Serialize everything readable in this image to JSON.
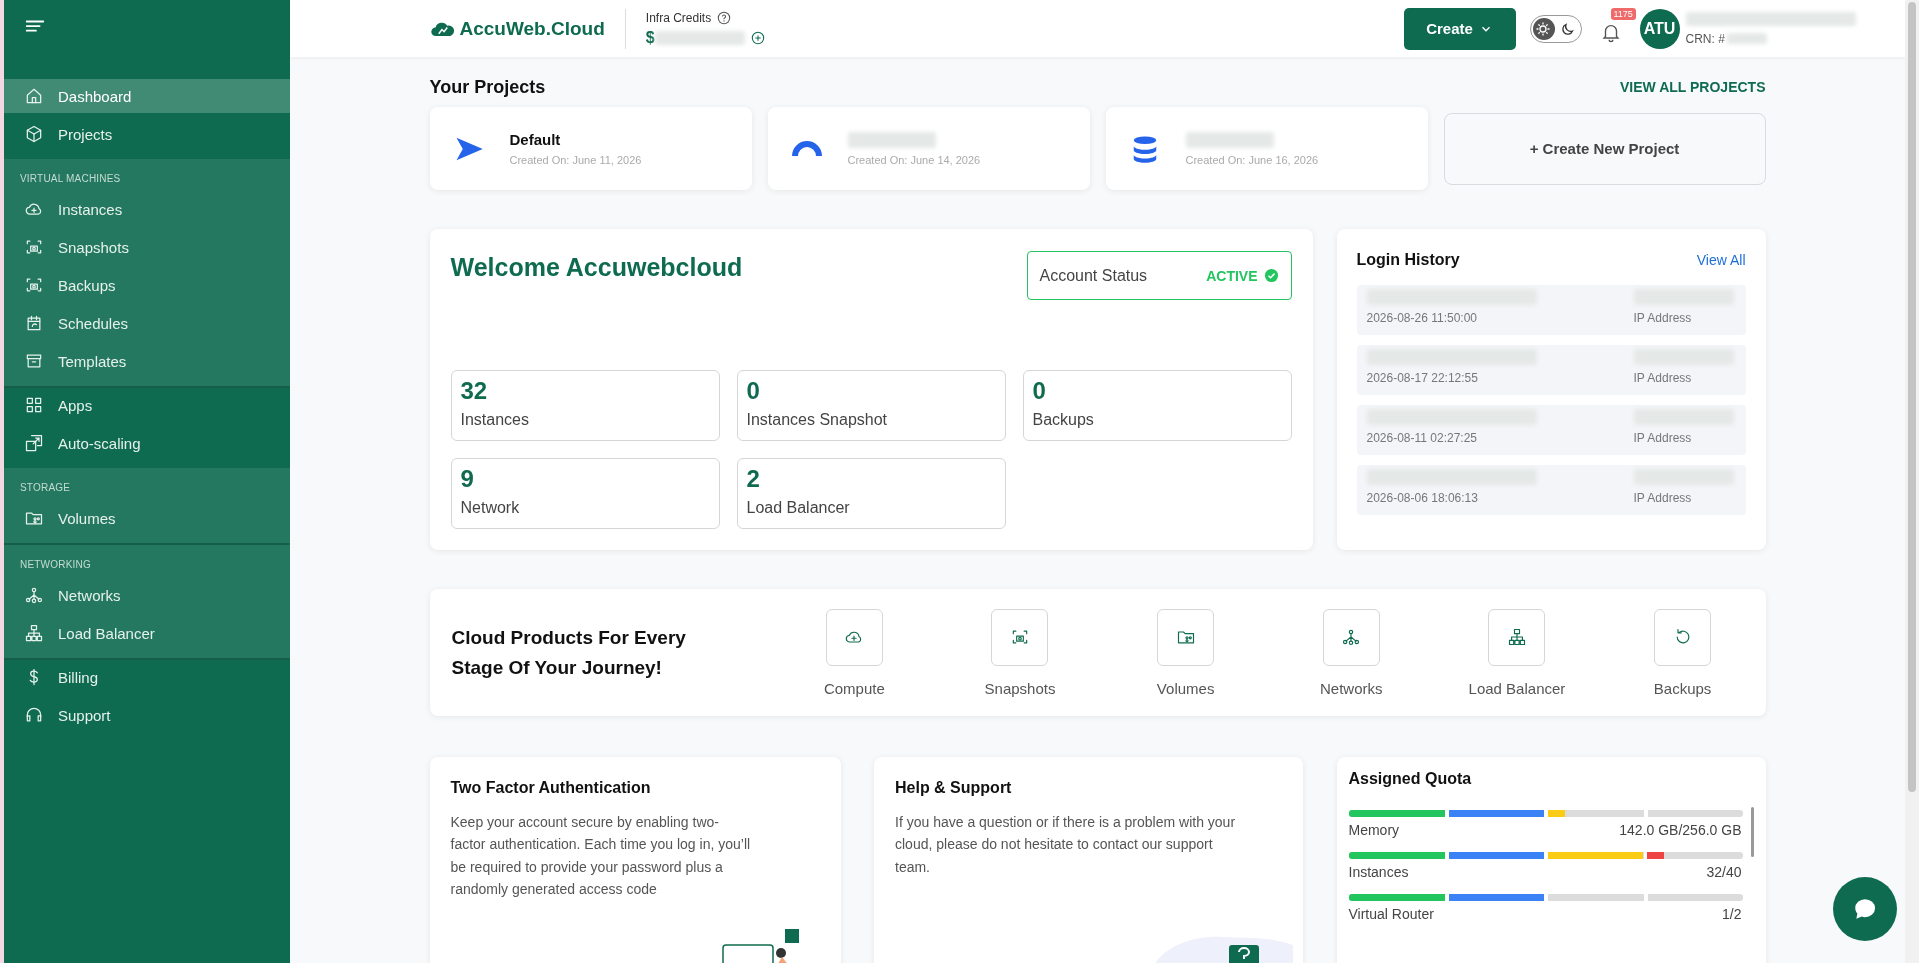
{
  "sidebar": {
    "sections": [
      {
        "kind": "main",
        "items": [
          {
            "label": "Dashboard",
            "selected": true
          },
          {
            "label": "Projects",
            "selected": false
          }
        ]
      },
      {
        "kind": "group",
        "heading": "VIRTUAL MACHINES",
        "items": [
          {
            "label": "Instances",
            "selected": false
          },
          {
            "label": "Snapshots",
            "selected": false
          },
          {
            "label": "Backups",
            "selected": false
          },
          {
            "label": "Schedules",
            "selected": false
          },
          {
            "label": "Templates",
            "selected": false
          }
        ]
      },
      {
        "kind": "main",
        "items": [
          {
            "label": "Apps",
            "selected": false
          },
          {
            "label": "Auto-scaling",
            "selected": false
          }
        ]
      },
      {
        "kind": "group",
        "heading": "STORAGE",
        "items": [
          {
            "label": "Volumes",
            "selected": false
          }
        ]
      },
      {
        "kind": "group",
        "heading": "NETWORKING",
        "items": [
          {
            "label": "Networks",
            "selected": false
          },
          {
            "label": "Load Balancer",
            "selected": false
          }
        ]
      },
      {
        "kind": "main",
        "items": [
          {
            "label": "Billing",
            "selected": false
          },
          {
            "label": "Support",
            "selected": false
          }
        ]
      }
    ]
  },
  "header": {
    "logo": "AccuWeb.Cloud",
    "credits_label": "Infra Credits",
    "credits_value": "$",
    "create_button": "Create",
    "dark_mode": false,
    "notifications": "1175",
    "avatar": "ATU",
    "crn": "CRN: #"
  },
  "projects": {
    "title": "Your Projects",
    "view_all": "VIEW ALL PROJECTS",
    "create_new": "+ Create New Project",
    "items": [
      {
        "name": "Default",
        "created": "Created On: June 11, 2026"
      },
      {
        "created": "Created On: June 14, 2026"
      },
      {
        "created": "Created On: June 16, 2026"
      }
    ]
  },
  "welcome": {
    "title": "Welcome Accuwebcloud",
    "status_label": "Account Status",
    "status": "ACTIVE",
    "stats": [
      {
        "value": "32",
        "label": "Instances"
      },
      {
        "value": "0",
        "label": "Instances Snapshot"
      },
      {
        "value": "0",
        "label": "Backups"
      },
      {
        "value": "9",
        "label": "Network"
      },
      {
        "value": "2",
        "label": "Load Balancer"
      }
    ]
  },
  "login_history": {
    "title": "Login History",
    "view_all": "View All",
    "entries": [
      {
        "time": "2026-08-26 11:50:00",
        "ip_label": "IP Address"
      },
      {
        "time": "2026-08-17 22:12:55",
        "ip_label": "IP Address"
      },
      {
        "time": "2026-08-11 02:27:25",
        "ip_label": "IP Address"
      },
      {
        "time": "2026-08-06 18:06:13",
        "ip_label": "IP Address"
      }
    ]
  },
  "products": {
    "title": "Cloud Products For Every Stage Of Your Journey!",
    "items": [
      "Compute",
      "Snapshots",
      "Volumes",
      "Networks",
      "Load Balancer",
      "Backups"
    ]
  },
  "two_factor": {
    "title": "Two Factor Authentication",
    "text": "Keep your account secure by enabling two-factor authentication. Each time you log in, you’ll be required to provide your password plus a randomly generated access code"
  },
  "help": {
    "title": "Help & Support",
    "text": "If you have a question or if there is a problem with your cloud, please do not hesitate to contact our support team."
  },
  "quota": {
    "title": "Assigned Quota",
    "items": [
      {
        "name": "Memory",
        "reading": "142.0 GB/256.0 GB",
        "level": 0.55
      },
      {
        "name": "Instances",
        "reading": "32/40",
        "level": 0.8
      },
      {
        "name": "Virtual Router",
        "reading": "1/2",
        "level": 0.5
      }
    ]
  }
}
